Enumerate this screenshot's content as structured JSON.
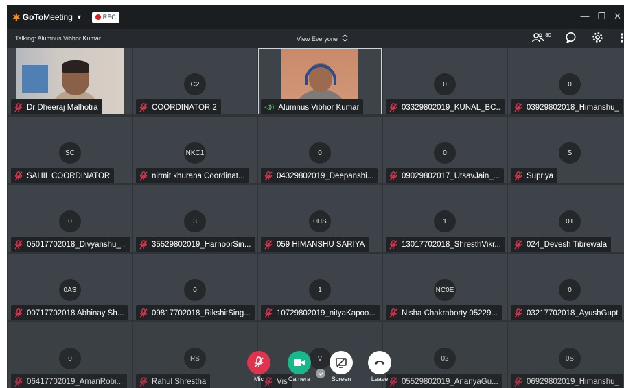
{
  "titlebar": {
    "app_name_bold": "GoTo",
    "app_name_rest": "Meeting",
    "rec_label": "REC"
  },
  "toolbar": {
    "talking": "Talking: Alumnus Vibhor Kumar",
    "view_selector": "View Everyone",
    "participant_count": "80"
  },
  "colors": {
    "brand_orange": "#f68d2e",
    "mic_muted": "#e5334b",
    "mic_button": "#e0344e",
    "camera_button": "#18b88a",
    "speaking_green": "#6fd36a"
  },
  "participants": [
    {
      "name": "Dr Dheeraj Malhotra",
      "initials": "",
      "video": true,
      "status": "muted"
    },
    {
      "name": "COORDINATOR 2",
      "initials": "C2",
      "video": false,
      "status": "muted"
    },
    {
      "name": "Alumnus Vibhor Kumar",
      "initials": "",
      "video": true,
      "status": "speaking"
    },
    {
      "name": "03329802019_KUNAL_BC...",
      "initials": "0",
      "video": false,
      "status": "muted"
    },
    {
      "name": "03929802018_Himanshu_",
      "initials": "0",
      "video": false,
      "status": "muted"
    },
    {
      "name": "SAHIL COORDINATOR",
      "initials": "SC",
      "video": false,
      "status": "muted"
    },
    {
      "name": "nirmit khurana Coordinat...",
      "initials": "NKC1",
      "video": false,
      "status": "muted"
    },
    {
      "name": "04329802019_Deepanshi...",
      "initials": "0",
      "video": false,
      "status": "muted"
    },
    {
      "name": "09029802017_UtsavJain_...",
      "initials": "0",
      "video": false,
      "status": "muted"
    },
    {
      "name": "Supriya",
      "initials": "S",
      "video": false,
      "status": "muted"
    },
    {
      "name": "05017702018_Divyanshu_...",
      "initials": "0",
      "video": false,
      "status": "muted"
    },
    {
      "name": "35529802019_HarnoorSin...",
      "initials": "3",
      "video": false,
      "status": "muted"
    },
    {
      "name": "059 HIMANSHU SARIYA",
      "initials": "0HS",
      "video": false,
      "status": "muted"
    },
    {
      "name": "13017702018_ShresthVikr...",
      "initials": "1",
      "video": false,
      "status": "muted"
    },
    {
      "name": "024_Devesh Tibrewala",
      "initials": "0T",
      "video": false,
      "status": "muted"
    },
    {
      "name": "00717702018 Abhinay Sh...",
      "initials": "0AS",
      "video": false,
      "status": "muted"
    },
    {
      "name": "09817702018_RikshitSing...",
      "initials": "0",
      "video": false,
      "status": "muted"
    },
    {
      "name": "10729802019_nityaKapoo...",
      "initials": "1",
      "video": false,
      "status": "muted"
    },
    {
      "name": "Nisha Chakraborty 05229...",
      "initials": "NC0E",
      "video": false,
      "status": "muted"
    },
    {
      "name": "03217702018_AyushGupt",
      "initials": "0",
      "video": false,
      "status": "muted"
    },
    {
      "name": "06417702019_AmanRobi...",
      "initials": "0",
      "video": false,
      "status": "muted"
    },
    {
      "name": "Rahul Shrestha",
      "initials": "RS",
      "video": false,
      "status": "muted"
    },
    {
      "name": "Vis",
      "initials": "V",
      "video": false,
      "status": "muted"
    },
    {
      "name": "05529802019_AnanyaGu...",
      "initials": "02",
      "video": false,
      "status": "muted"
    },
    {
      "name": "06929802019_Himanshu_",
      "initials": "0S",
      "video": false,
      "status": "muted"
    }
  ],
  "controls": {
    "mic": "Mic",
    "camera": "Camera",
    "screen": "Screen",
    "leave": "Leave"
  }
}
